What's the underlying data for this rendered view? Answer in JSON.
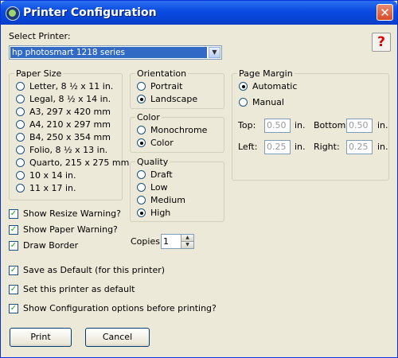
{
  "window": {
    "title": "Printer Configuration",
    "close_glyph": "✕"
  },
  "help": {
    "glyph": "?"
  },
  "printer": {
    "label": "Select Printer:",
    "selected": "hp photosmart 1218 series"
  },
  "paper_size": {
    "title": "Paper Size",
    "options": [
      {
        "label": "Letter, 8 ½ x 11 in.",
        "selected": false
      },
      {
        "label": "Legal, 8 ½ x 14 in.",
        "selected": false
      },
      {
        "label": "A3, 297 x 420 mm",
        "selected": false
      },
      {
        "label": "A4, 210 x 297 mm",
        "selected": false
      },
      {
        "label": "B4, 250 x 354 mm",
        "selected": false
      },
      {
        "label": "Folio, 8 ½ x 13 in.",
        "selected": false
      },
      {
        "label": "Quarto, 215 x 275 mm",
        "selected": false
      },
      {
        "label": "10 x 14 in.",
        "selected": false
      },
      {
        "label": "11 x 17 in.",
        "selected": false
      }
    ]
  },
  "orientation": {
    "title": "Orientation",
    "options": [
      {
        "label": "Portrait",
        "selected": false
      },
      {
        "label": "Landscape",
        "selected": true
      }
    ]
  },
  "color": {
    "title": "Color",
    "options": [
      {
        "label": "Monochrome",
        "selected": false
      },
      {
        "label": "Color",
        "selected": true
      }
    ]
  },
  "quality": {
    "title": "Quality",
    "options": [
      {
        "label": "Draft",
        "selected": false
      },
      {
        "label": "Low",
        "selected": false
      },
      {
        "label": "Medium",
        "selected": false
      },
      {
        "label": "High",
        "selected": true
      }
    ]
  },
  "page_margin": {
    "title": "Page Margin",
    "automatic_label": "Automatic",
    "manual_label": "Manual",
    "mode": "Automatic",
    "top_label": "Top:",
    "top_value": "0.50",
    "bottom_label": "Bottom:",
    "bottom_value": "0.50",
    "left_label": "Left:",
    "left_value": "0.25",
    "right_label": "Right:",
    "right_value": "0.25",
    "unit": "in."
  },
  "options": {
    "show_resize_warning": {
      "label": "Show Resize Warning?",
      "checked": true
    },
    "show_paper_warning": {
      "label": "Show Paper Warning?",
      "checked": true
    },
    "draw_border": {
      "label": "Draw Border",
      "checked": true
    },
    "save_default": {
      "label": "Save as Default (for this printer)",
      "checked": true
    },
    "set_default_printer": {
      "label": "Set this printer as default",
      "checked": true
    },
    "show_config": {
      "label": "Show Configuration options before printing?",
      "checked": true
    }
  },
  "copies": {
    "label": "Copies",
    "value": "1"
  },
  "buttons": {
    "print": "Print",
    "cancel": "Cancel"
  },
  "colors": {
    "titlebar": "#0a4ae0",
    "dialog_bg": "#ece9d8",
    "selection": "#316ac5",
    "radio_dot": "#21a121"
  }
}
